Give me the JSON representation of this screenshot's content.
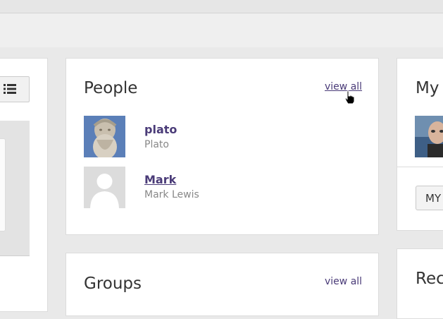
{
  "people_card": {
    "title": "People",
    "view_all": "view all",
    "people": [
      {
        "username": "plato",
        "full_name": "Plato"
      },
      {
        "username": "Mark",
        "full_name": "Mark Lewis"
      }
    ]
  },
  "groups_card": {
    "title": "Groups",
    "view_all": "view all"
  },
  "my_card": {
    "title": "My",
    "button_label": "MY"
  },
  "rec_card": {
    "title": "Rec"
  },
  "colors": {
    "link": "#4a3b78",
    "panel_bg": "#ffffff",
    "page_bg": "#e9e9e9"
  },
  "icons": [
    "list-icon",
    "hand-cursor-icon"
  ]
}
